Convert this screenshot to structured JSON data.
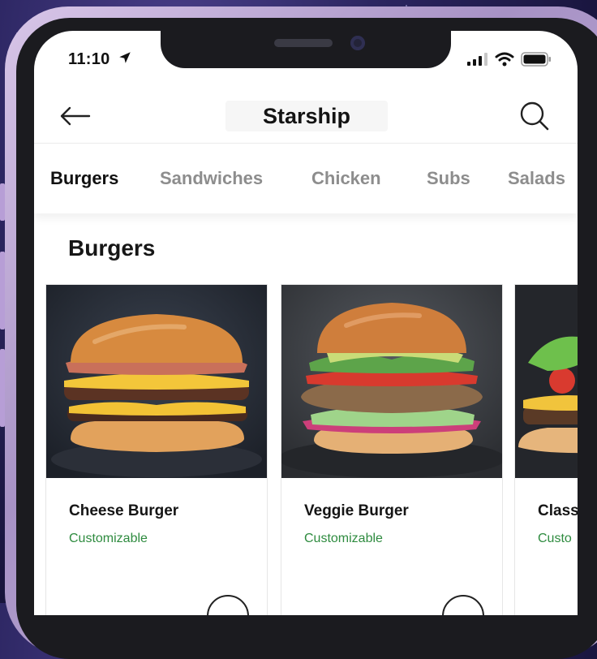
{
  "status_bar": {
    "time": "11:10"
  },
  "header": {
    "title": "Starship"
  },
  "tabs": [
    {
      "label": "Burgers",
      "active": true
    },
    {
      "label": "Sandwiches",
      "active": false
    },
    {
      "label": "Chicken",
      "active": false
    },
    {
      "label": "Subs",
      "active": false
    },
    {
      "label": "Salads",
      "active": false
    }
  ],
  "section": {
    "title": "Burgers"
  },
  "items": [
    {
      "name": "Cheese Burger",
      "tag": "Customizable"
    },
    {
      "name": "Veggie Burger",
      "tag": "Customizable"
    },
    {
      "name": "Class",
      "tag": "Custo"
    }
  ],
  "colors": {
    "accent_green": "#2e8b3f",
    "background_purple": "#2b2560"
  },
  "icons": [
    "location-arrow-icon",
    "signal-icon",
    "wifi-icon",
    "battery-icon",
    "back-arrow-icon",
    "search-icon",
    "add-icon"
  ]
}
